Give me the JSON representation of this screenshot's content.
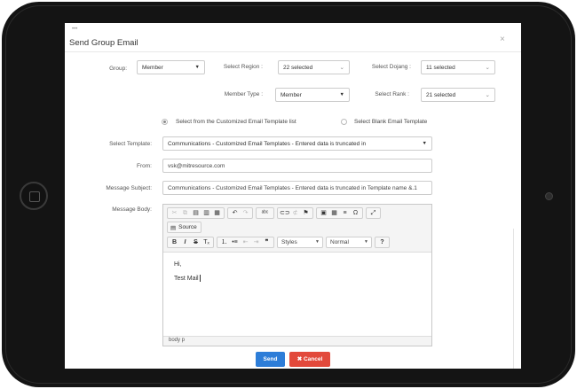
{
  "modal": {
    "title": "Send Group Email",
    "close": "×",
    "dots": "•••"
  },
  "filters": {
    "group": {
      "label": "Group:",
      "value": "Member"
    },
    "region": {
      "label": "Select Region :",
      "value": "22 selected"
    },
    "dojang": {
      "label": "Select Dojang :",
      "value": "11 selected"
    },
    "member_type": {
      "label": "Member Type :",
      "value": "Member"
    },
    "rank": {
      "label": "Select Rank :",
      "value": "21 selected"
    }
  },
  "template_choice": {
    "option_custom": "Select from the Customized Email Template list",
    "option_blank": "Select Blank Email Template",
    "selected": "custom"
  },
  "form": {
    "template_label": "Select Template:",
    "template_value": "Communications - Customized Email Templates - Entered data is truncated in",
    "from_label": "From:",
    "from_value": "vsk@mitresource.com",
    "subject_label": "Message Subject:",
    "subject_value": "Communications - Customized Email Templates - Entered data is truncated in Template name &.1",
    "body_label": "Message Body:"
  },
  "editor": {
    "source_label": "Source",
    "styles_label": "Styles",
    "format_label": "Normal",
    "help_label": "?",
    "body_lines": [
      "Hi,",
      "Test Mail"
    ],
    "path": "body  p"
  },
  "actions": {
    "send_label": "Send",
    "cancel_label": "✖ Cancel"
  },
  "colors": {
    "send": "#2d7dd8",
    "cancel": "#e2493b"
  }
}
